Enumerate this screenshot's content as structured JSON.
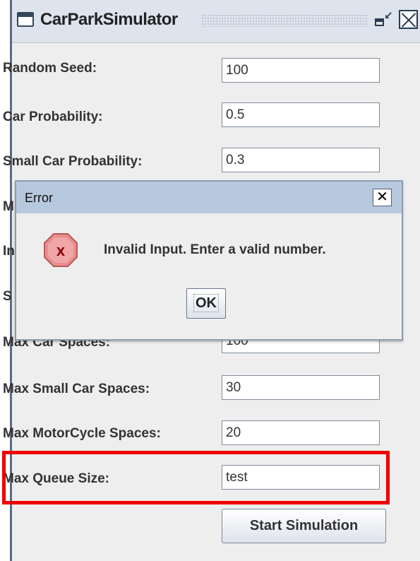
{
  "window": {
    "title": "CarParkSimulator",
    "icons": [
      "window-icon",
      "minimize-icon",
      "close-icon"
    ]
  },
  "form": {
    "fields": [
      {
        "label": "Random Seed:",
        "value": "100"
      },
      {
        "label": "Car Probability:",
        "value": "0.5"
      },
      {
        "label": "Small Car Probability:",
        "value": "0.3"
      },
      {
        "label": "M",
        "value": ""
      },
      {
        "label": "In",
        "value": ""
      },
      {
        "label": "S",
        "value": ""
      },
      {
        "label": "Max Car Spaces:",
        "value": "100"
      },
      {
        "label": "Max Small Car Spaces:",
        "value": "30"
      },
      {
        "label": "Max MotorCycle Spaces:",
        "value": "20"
      },
      {
        "label": "Max Queue Size:",
        "value": "test"
      }
    ],
    "start_button": "Start Simulation"
  },
  "dialog": {
    "title": "Error",
    "message": "Invalid Input. Enter a valid number.",
    "ok": "OK",
    "close": "✕"
  },
  "colors": {
    "highlight": "#ee0000",
    "dialog_titlebar": "#b7c9de",
    "error_icon": "#e88e8e"
  }
}
